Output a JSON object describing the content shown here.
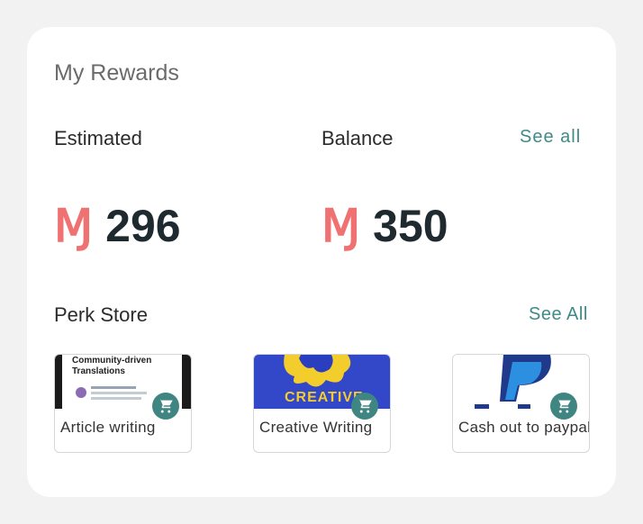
{
  "rewards": {
    "title": "My Rewards",
    "estimated": {
      "label": "Estimated",
      "currency_symbol": "Ɱ",
      "amount": "296"
    },
    "balance": {
      "label": "Balance",
      "see_all": "See all",
      "currency_symbol": "Ɱ",
      "amount": "350"
    }
  },
  "perk_store": {
    "title": "Perk Store",
    "see_all": "See All",
    "items": [
      {
        "label": "Article writing",
        "thumb_text": "Community-driven Translations",
        "icon": "cart-icon"
      },
      {
        "label": "Creative Writing",
        "thumb_text": "CREATIVE",
        "icon": "cart-icon"
      },
      {
        "label": "Cash out to paypal",
        "icon": "cart-icon"
      }
    ]
  },
  "colors": {
    "accent": "#3d8a87",
    "currency": "#f07171",
    "amount": "#1f2a30"
  }
}
